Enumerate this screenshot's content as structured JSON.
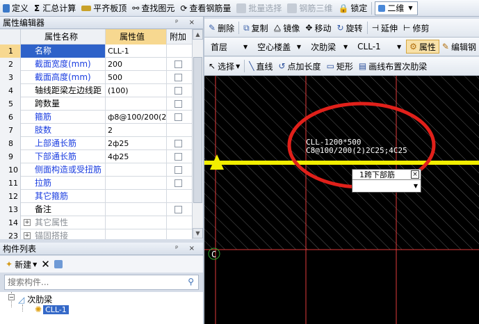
{
  "top_toolbar": {
    "items": [
      {
        "label": "定义",
        "enabled": true
      },
      {
        "label": "汇总计算",
        "enabled": true
      },
      {
        "label": "平齐板顶",
        "enabled": true
      },
      {
        "label": "查找图元",
        "enabled": true
      },
      {
        "label": "查看钢筋量",
        "enabled": true
      },
      {
        "label": "批量选择",
        "enabled": false
      },
      {
        "label": "钢筋三维",
        "enabled": false
      },
      {
        "label": "锁定",
        "enabled": true
      }
    ],
    "view_mode": "二维"
  },
  "property_editor": {
    "title": "属性编辑器",
    "headers": {
      "name": "属性名称",
      "value": "属性值",
      "add": "附加"
    },
    "rows": [
      {
        "num": "1",
        "name": "名称",
        "value": "CLL-1",
        "style": "blue",
        "checkbox": false,
        "expand": false
      },
      {
        "num": "2",
        "name": "截面宽度(mm)",
        "value": "200",
        "style": "blue",
        "checkbox": true,
        "expand": false
      },
      {
        "num": "3",
        "name": "截面高度(mm)",
        "value": "500",
        "style": "blue",
        "checkbox": true,
        "expand": false
      },
      {
        "num": "4",
        "name": "轴线距梁左边线距",
        "value": "(100)",
        "style": "black",
        "checkbox": true,
        "expand": false
      },
      {
        "num": "5",
        "name": "跨数量",
        "value": "",
        "style": "black",
        "checkbox": true,
        "expand": false
      },
      {
        "num": "6",
        "name": "箍筋",
        "value": "ф8@100/200(2",
        "style": "blue",
        "checkbox": true,
        "expand": false
      },
      {
        "num": "7",
        "name": "肢数",
        "value": "2",
        "style": "blue",
        "checkbox": false,
        "expand": false
      },
      {
        "num": "8",
        "name": "上部通长筋",
        "value": "2ф25",
        "style": "blue",
        "checkbox": true,
        "expand": false
      },
      {
        "num": "9",
        "name": "下部通长筋",
        "value": "4ф25",
        "style": "blue",
        "checkbox": true,
        "expand": false
      },
      {
        "num": "10",
        "name": "侧面构造或受扭筋",
        "value": "",
        "style": "blue",
        "checkbox": true,
        "expand": false
      },
      {
        "num": "11",
        "name": "拉筋",
        "value": "",
        "style": "blue",
        "checkbox": true,
        "expand": false
      },
      {
        "num": "12",
        "name": "其它箍筋",
        "value": "",
        "style": "blue",
        "checkbox": false,
        "expand": false
      },
      {
        "num": "13",
        "name": "备注",
        "value": "",
        "style": "black",
        "checkbox": true,
        "expand": false
      },
      {
        "num": "14",
        "name": "其它属性",
        "value": "",
        "style": "gray",
        "checkbox": false,
        "expand": true
      },
      {
        "num": "23",
        "name": "锚固搭接",
        "value": "",
        "style": "gray",
        "checkbox": false,
        "expand": true
      }
    ]
  },
  "component_list": {
    "title": "构件列表",
    "new_label": "新建",
    "search_placeholder": "搜索构件...",
    "tree": {
      "parent": "次肋梁",
      "child": "CLL-1"
    }
  },
  "edit_toolbar": {
    "items": [
      "删除",
      "复制",
      "镜像",
      "移动",
      "旋转",
      "延伸",
      "修剪"
    ]
  },
  "layer_toolbar": {
    "floor": "首层",
    "category": "空心楼盖",
    "type": "次肋梁",
    "component": "CLL-1",
    "property_label": "属性",
    "edit_label": "编辑钢"
  },
  "draw_toolbar": {
    "items": [
      "选择",
      "直线",
      "点加长度",
      "矩形",
      "画线布置次肋梁"
    ]
  },
  "cad": {
    "annotation_line1": "CLL-1200*500",
    "annotation_line2": "C8@100/200(2)2C25;4C25",
    "popup_label": "1跨下部筋",
    "axis_label": "C",
    "colors": {
      "beam": "#f2ee00",
      "grid": "#e03a3a",
      "circle": "#e0201a",
      "hatch": "#5a5a5a"
    }
  }
}
